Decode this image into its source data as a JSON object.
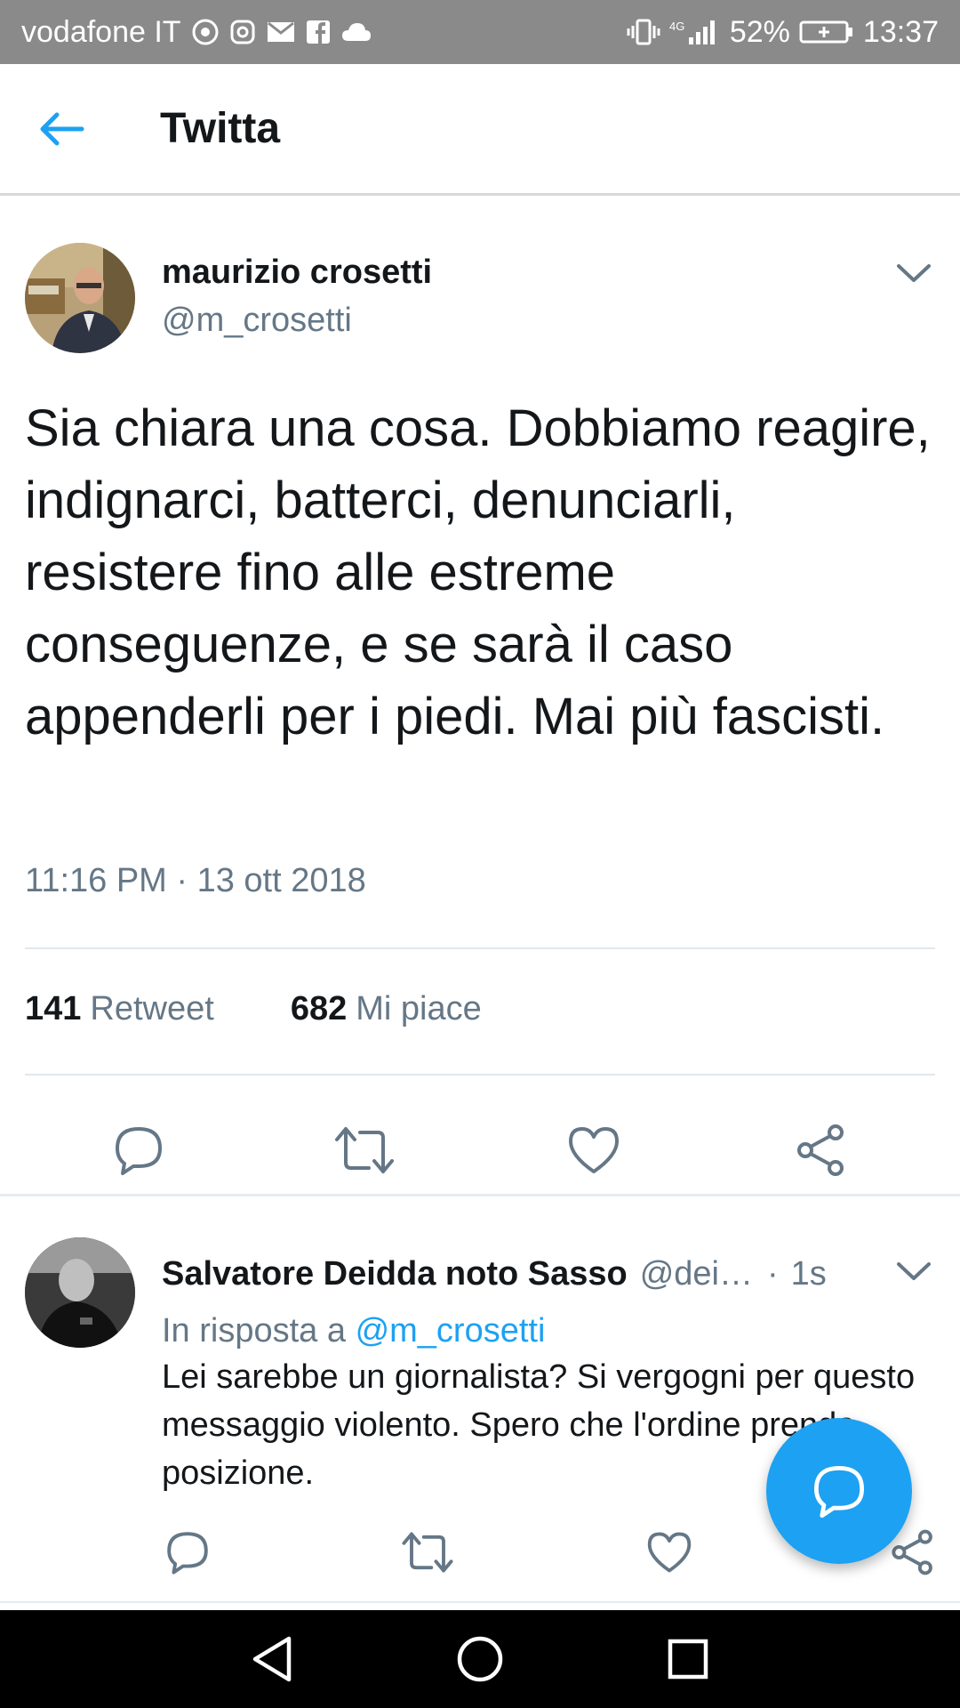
{
  "status_bar": {
    "carrier": "vodafone IT",
    "network": "4G",
    "battery": "52%",
    "time": "13:37",
    "notification_icons": [
      "chrome-icon",
      "instagram-icon",
      "mail-icon",
      "facebook-icon",
      "cloud-icon"
    ]
  },
  "header": {
    "title": "Twitta"
  },
  "tweet": {
    "author_name": "maurizio crosetti",
    "author_handle": "@m_crosetti",
    "text": "Sia chiara una cosa. Dobbiamo reagire, indignarci, batterci, denunciarli, resistere fino alle estreme conseguenze, e se sarà il caso appenderli per i piedi. Mai più fascisti.",
    "timestamp": "11:16 PM · 13 ott 2018",
    "retweet_count": "141",
    "retweet_label": "Retweet",
    "like_count": "682",
    "like_label": "Mi piace"
  },
  "reply": {
    "author_name": "Salvatore Deidda noto Sasso",
    "author_handle": "@dei…",
    "separator": "·",
    "time": "1s",
    "in_reply_prefix": "In risposta a",
    "in_reply_handle": "@m_crosetti",
    "text": "Lei sarebbe un giornalista? Si vergogni per questo messaggio violento. Spero che l'ordine prenda posizione."
  },
  "colors": {
    "accent": "#1da1f2",
    "text_primary": "#14171a",
    "text_secondary": "#657786",
    "status_bar": "#8a8a8a",
    "nav_bar": "#000000"
  }
}
